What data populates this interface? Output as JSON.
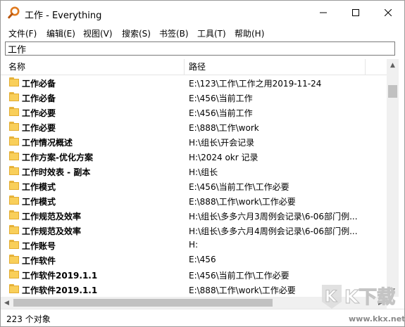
{
  "window": {
    "title": "工作 - Everything"
  },
  "menu": [
    "文件(F)",
    "编辑(E)",
    "视图(V)",
    "搜索(S)",
    "书签(B)",
    "工具(T)",
    "帮助(H)"
  ],
  "search": {
    "value": "工作"
  },
  "columns": {
    "name": "名称",
    "path": "路径"
  },
  "rows": [
    {
      "name": "工作必备",
      "path": "E:\\123\\工作\\工作之用2019-11-24"
    },
    {
      "name": "工作必备",
      "path": "E:\\456\\当前工作"
    },
    {
      "name": "工作必要",
      "path": "E:\\456\\当前工作"
    },
    {
      "name": "工作必要",
      "path": "E:\\888\\工作\\work"
    },
    {
      "name": "工作情况概述",
      "path": "H:\\组长\\开会记录"
    },
    {
      "name": "工作方案-优化方案",
      "path": "H:\\2024 okr 记录"
    },
    {
      "name": "工作时效表 - 副本",
      "path": "H:\\组长"
    },
    {
      "name": "工作模式",
      "path": "E:\\456\\当前工作\\工作必要"
    },
    {
      "name": "工作模式",
      "path": "E:\\888\\工作\\work\\工作必要"
    },
    {
      "name": "工作规范及效率",
      "path": "H:\\组长\\多多六月3周例会记录\\6-06部门例..."
    },
    {
      "name": "工作规范及效率",
      "path": "H:\\组长\\多多六月4周例会记录\\6-06部门例..."
    },
    {
      "name": "工作账号",
      "path": "H:"
    },
    {
      "name": "工作软件",
      "path": "E:\\456"
    },
    {
      "name": "工作软件2019.1.1",
      "path": "E:\\456\\当前工作\\工作必要"
    },
    {
      "name": "工作软件2019.1.1",
      "path": "E:\\888\\工作\\work\\工作必要"
    }
  ],
  "status": {
    "text": "223 个对象"
  },
  "watermark": {
    "logo_text": "KK下载",
    "url": "www.kkx.net"
  },
  "colors": {
    "folder": "#f9cf5a",
    "search_icon": "#e07a1f",
    "scrollbar_thumb": "#c1c1c1"
  },
  "icons": {
    "app": "magnifier-icon",
    "minimize": "minimize-icon",
    "maximize": "maximize-icon",
    "close": "close-icon",
    "folder": "folder-icon"
  }
}
